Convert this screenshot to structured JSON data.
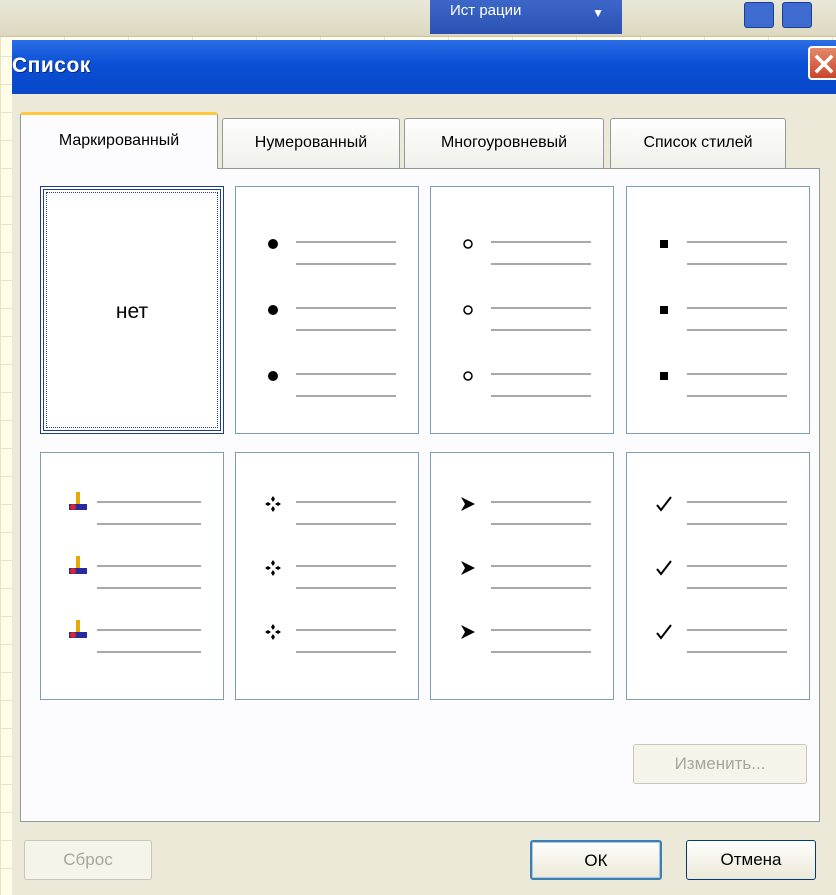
{
  "top_bar": {
    "dropdown_label": "Ист рации",
    "dropdown_arrow": "▼"
  },
  "dialog": {
    "title": "Список"
  },
  "tabs": [
    {
      "label": "Маркированный",
      "active": true
    },
    {
      "label": "Нумерованный",
      "active": false
    },
    {
      "label": "Многоуровневый",
      "active": false
    },
    {
      "label": "Список стилей",
      "active": false
    }
  ],
  "bullet_options": [
    {
      "label": "нет",
      "icon": "none",
      "selected": true
    },
    {
      "icon": "filled-circle-bullet-icon"
    },
    {
      "icon": "hollow-circle-bullet-icon"
    },
    {
      "icon": "square-bullet-icon"
    },
    {
      "icon": "colored-pin-bullet-icon"
    },
    {
      "icon": "diamond-dots-bullet-icon"
    },
    {
      "icon": "arrowhead-bullet-icon"
    },
    {
      "icon": "checkmark-bullet-icon"
    }
  ],
  "buttons": {
    "modify": "Изменить...",
    "reset": "Сброс",
    "ok": "ОК",
    "cancel": "Отмена"
  },
  "colors": {
    "title_bar": "#0a4fd6",
    "accent_tab": "#ffc83d",
    "selection": "#1f3d8a"
  }
}
